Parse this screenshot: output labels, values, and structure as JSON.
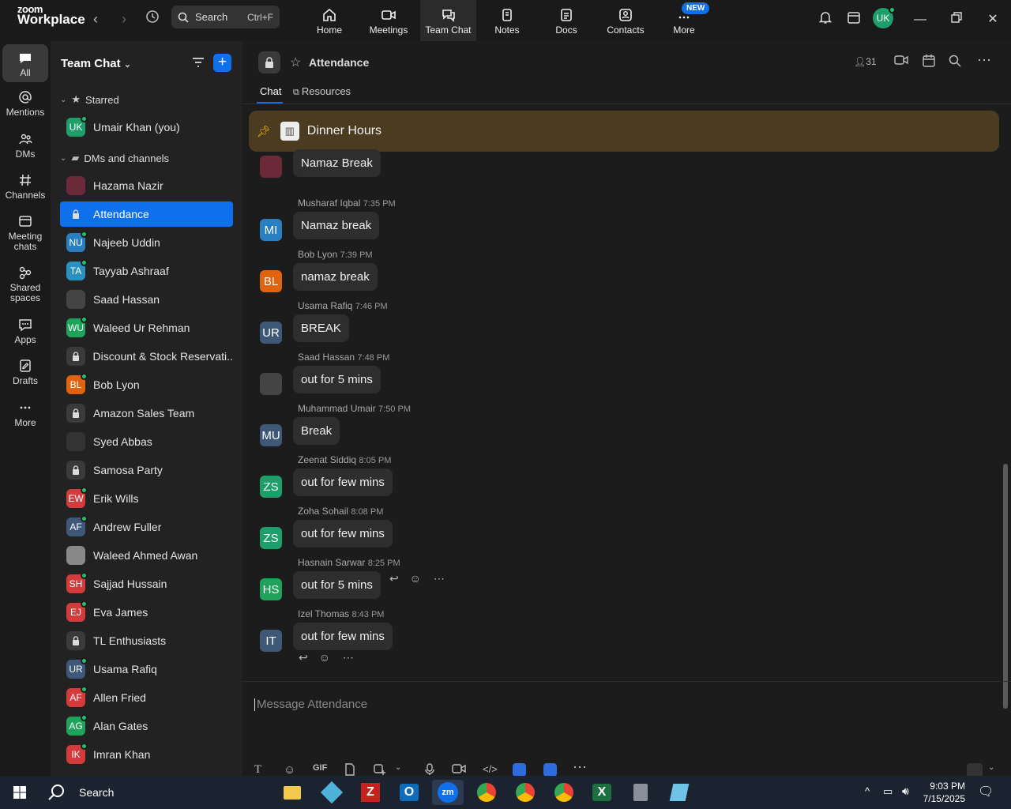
{
  "app": {
    "logo_top": "zoom",
    "logo_bottom": "Workplace"
  },
  "search": {
    "label": "Search",
    "shortcut": "Ctrl+F"
  },
  "tabs": [
    {
      "label": "Home",
      "icon": "home-icon"
    },
    {
      "label": "Meetings",
      "icon": "video-icon"
    },
    {
      "label": "Team Chat",
      "icon": "chat-icon"
    },
    {
      "label": "Notes",
      "icon": "notes-icon"
    },
    {
      "label": "Docs",
      "icon": "docs-icon"
    },
    {
      "label": "Contacts",
      "icon": "contacts-icon"
    },
    {
      "label": "More",
      "icon": "more-icon",
      "badge": "NEW"
    }
  ],
  "user": {
    "initials": "UK",
    "color": "#1d9e6a"
  },
  "rail": [
    {
      "label": "All"
    },
    {
      "label": "Mentions"
    },
    {
      "label": "DMs"
    },
    {
      "label": "Channels"
    },
    {
      "label": "Meeting chats"
    },
    {
      "label": "Shared spaces"
    },
    {
      "label": "Apps"
    },
    {
      "label": "Drafts"
    },
    {
      "label": "More"
    }
  ],
  "sidebar": {
    "title": "Team Chat",
    "starred_label": "Starred",
    "starred": [
      {
        "name": "Umair Khan (you)",
        "initials": "UK",
        "color": "#1d9e6a"
      }
    ],
    "dms_label": "DMs and channels",
    "items": [
      {
        "name": "Hazama Nazir",
        "initials": "",
        "color": "#6a2a3a",
        "type": "avatar"
      },
      {
        "name": "Attendance",
        "type": "channel",
        "active": true
      },
      {
        "name": "Najeeb Uddin",
        "initials": "NU",
        "color": "#2a7fc1",
        "type": "avatar"
      },
      {
        "name": "Tayyab Ashraaf",
        "initials": "TA",
        "color": "#2a8fc1",
        "type": "avatar"
      },
      {
        "name": "Saad Hassan",
        "initials": "",
        "color": "#444",
        "type": "avatar"
      },
      {
        "name": "Waleed Ur Rehman",
        "initials": "WU",
        "color": "#1fa35a",
        "type": "avatar"
      },
      {
        "name": "Discount & Stock Reservati...",
        "type": "channel"
      },
      {
        "name": "Bob Lyon",
        "initials": "BL",
        "color": "#e0630f",
        "type": "avatar"
      },
      {
        "name": "Amazon Sales Team",
        "type": "channel"
      },
      {
        "name": "Syed Abbas",
        "initials": "",
        "color": "#333",
        "type": "avatar"
      },
      {
        "name": "Samosa Party",
        "type": "channel"
      },
      {
        "name": "Erik Wills",
        "initials": "EW",
        "color": "#d33c3c",
        "type": "avatar"
      },
      {
        "name": "Andrew Fuller",
        "initials": "AF",
        "color": "#3f5878",
        "type": "avatar"
      },
      {
        "name": "Waleed Ahmed Awan",
        "initials": "",
        "color": "#888",
        "type": "avatar"
      },
      {
        "name": "Sajjad Hussain",
        "initials": "SH",
        "color": "#d33c3c",
        "type": "avatar"
      },
      {
        "name": "Eva James",
        "initials": "EJ",
        "color": "#d33c3c",
        "type": "avatar"
      },
      {
        "name": "TL Enthusiasts",
        "type": "channel"
      },
      {
        "name": "Usama Rafiq",
        "initials": "UR",
        "color": "#3f5878",
        "type": "avatar"
      },
      {
        "name": "Allen Fried",
        "initials": "AF",
        "color": "#d33c3c",
        "type": "avatar"
      },
      {
        "name": "Alan Gates",
        "initials": "AG",
        "color": "#1fa35a",
        "type": "avatar"
      },
      {
        "name": "Imran Khan",
        "initials": "IK",
        "color": "#d33c3c",
        "type": "avatar"
      }
    ]
  },
  "channel": {
    "name": "Attendance",
    "members": "31",
    "tabs": [
      "Chat",
      "Resources"
    ]
  },
  "pinned": {
    "label": "Dinner Hours"
  },
  "messages": [
    {
      "author": "",
      "time": "",
      "text": "Namaz Break",
      "initials": "",
      "color": "#6a2a3a"
    },
    {
      "author": "Musharaf Iqbal",
      "time": "7:35 PM",
      "text": "Namaz break",
      "initials": "MI",
      "color": "#2a7fc1"
    },
    {
      "author": "Bob Lyon",
      "time": "7:39 PM",
      "text": "namaz break",
      "initials": "BL",
      "color": "#e0630f"
    },
    {
      "author": "Usama Rafiq",
      "time": "7:46 PM",
      "text": "BREAK",
      "initials": "UR",
      "color": "#3f5878"
    },
    {
      "author": "Saad Hassan",
      "time": "7:48 PM",
      "text": "out for 5 mins",
      "initials": "",
      "color": "#444"
    },
    {
      "author": "Muhammad Umair",
      "time": "7:50 PM",
      "text": "Break",
      "initials": "MU",
      "color": "#3f5878"
    },
    {
      "author": "Zeenat Siddiq",
      "time": "8:05 PM",
      "text": "out for few mins",
      "initials": "ZS",
      "color": "#1d9e6a"
    },
    {
      "author": "Zoha Sohail",
      "time": "8:08 PM",
      "text": "out for few mins",
      "initials": "ZS",
      "color": "#1d9e6a"
    },
    {
      "author": "Hasnain Sarwar",
      "time": "8:25 PM",
      "text": "out for 5 mins",
      "initials": "HS",
      "color": "#1fa35a"
    },
    {
      "author": "Izel Thomas",
      "time": "8:43 PM",
      "text": "out for few mins",
      "initials": "IT",
      "color": "#3f5878"
    }
  ],
  "composer": {
    "placeholder": "Message Attendance",
    "gif": "GIF"
  },
  "taskbar": {
    "search": "Search",
    "time": "9:03 PM",
    "date": "7/15/2025"
  }
}
